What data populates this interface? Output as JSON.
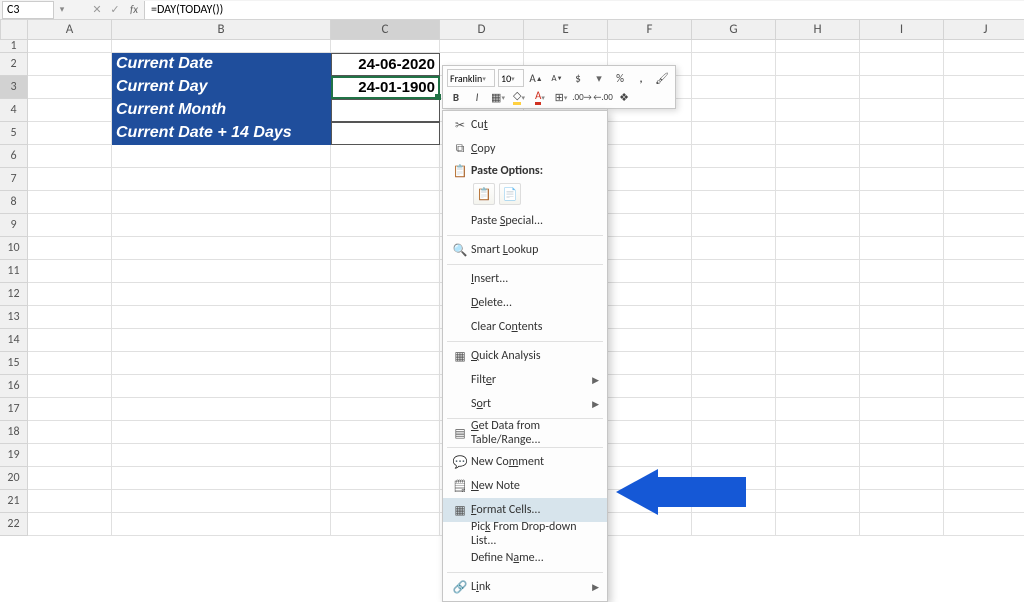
{
  "namebox": {
    "value": "C3"
  },
  "formula": {
    "value": "=DAY(TODAY())"
  },
  "columns": [
    "A",
    "B",
    "C",
    "D",
    "E",
    "F",
    "G",
    "H",
    "I",
    "J"
  ],
  "rows": [
    "1",
    "2",
    "3",
    "4",
    "5",
    "6",
    "7",
    "8",
    "9",
    "10",
    "11",
    "12",
    "13",
    "14",
    "15",
    "16",
    "17",
    "18",
    "19",
    "20",
    "21",
    "22"
  ],
  "table": {
    "r2b": "Current Date",
    "r2c": "24-06-2020",
    "r3b": "Current Day",
    "r3c": "24-01-1900",
    "r4b": "Current Month",
    "r5b": "Current Date + 14 Days"
  },
  "mini": {
    "font": "Franklin",
    "size": "10",
    "t_increase": "A",
    "t_decrease": "A",
    "t_dollar": "$",
    "t_percent": "%",
    "t_comma": ",",
    "t_bold": "B",
    "t_italic": "I"
  },
  "menu": {
    "cut": "Cut",
    "copy": "Copy",
    "paste_options": "Paste Options:",
    "paste_special": "Paste Special...",
    "smart_lookup": "Smart Lookup",
    "insert": "Insert...",
    "delete": "Delete...",
    "clear": "Clear Contents",
    "quick": "Quick Analysis",
    "filter": "Filter",
    "sort": "Sort",
    "get_data": "Get Data from Table/Range...",
    "new_comment": "New Comment",
    "new_note": "New Note",
    "format_cells": "Format Cells...",
    "pick": "Pick From Drop-down List...",
    "define": "Define Name...",
    "link": "Link"
  }
}
